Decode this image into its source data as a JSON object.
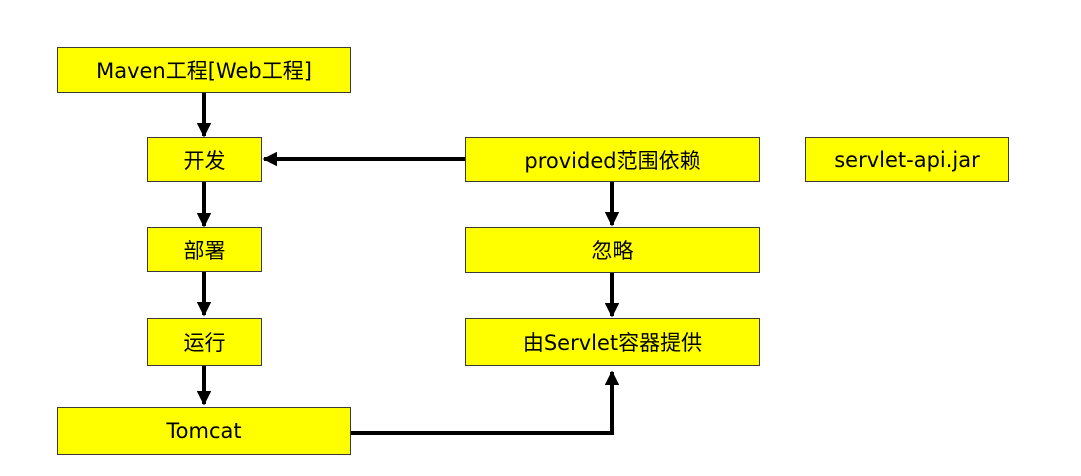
{
  "diagram": {
    "nodes": {
      "maven_project": "Maven工程[Web工程]",
      "develop": "开发",
      "deploy": "部署",
      "run": "运行",
      "tomcat": "Tomcat",
      "provided_scope": "provided范围依赖",
      "ignore": "忽略",
      "servlet_container": "由Servlet容器提供",
      "servlet_api_jar": "servlet-api.jar"
    },
    "edges": [
      {
        "from": "maven_project",
        "to": "develop"
      },
      {
        "from": "develop",
        "to": "deploy"
      },
      {
        "from": "deploy",
        "to": "run"
      },
      {
        "from": "run",
        "to": "tomcat"
      },
      {
        "from": "provided_scope",
        "to": "develop"
      },
      {
        "from": "provided_scope",
        "to": "ignore"
      },
      {
        "from": "ignore",
        "to": "servlet_container"
      },
      {
        "from": "tomcat",
        "to": "servlet_container"
      }
    ],
    "colors": {
      "node_fill": "#ffff00",
      "node_border": "#3a3a3a",
      "arrow": "#000000"
    }
  }
}
